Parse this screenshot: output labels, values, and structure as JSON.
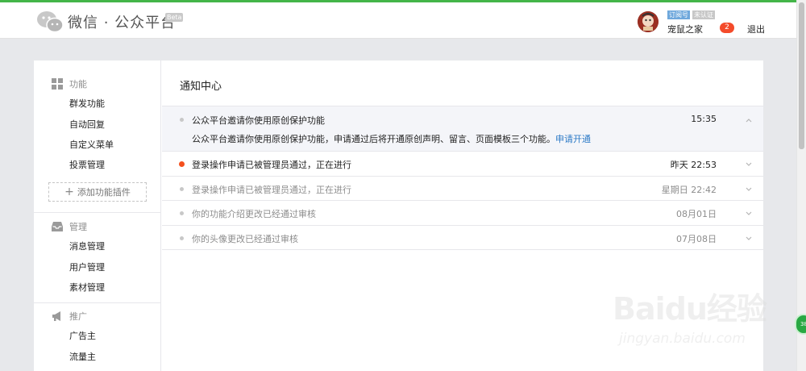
{
  "header": {
    "brand": "微信 · 公众平台",
    "beta": "Beta",
    "account_type_tag": "订阅号",
    "verify_tag": "未认证",
    "account_name": "宠鼠之家",
    "notice_count": "2",
    "logout_label": "退出"
  },
  "sidebar": {
    "groups": [
      {
        "label": "功能",
        "icon": "grid-icon",
        "items": [
          "群发功能",
          "自动回复",
          "自定义菜单",
          "投票管理"
        ]
      },
      {
        "label": "管理",
        "icon": "inbox-icon",
        "items": [
          "消息管理",
          "用户管理",
          "素材管理"
        ]
      },
      {
        "label": "推广",
        "icon": "megaphone-icon",
        "items": [
          "广告主",
          "流量主"
        ]
      }
    ],
    "add_plugin_label": "添加功能插件"
  },
  "main": {
    "title": "通知中心",
    "notifications": [
      {
        "title": "公众平台邀请你使用原创保护功能",
        "time": "15:35",
        "expanded": true,
        "unread": false,
        "detail": "公众平台邀请你使用原创保护功能，申请通过后将开通原创声明、留言、页面模板三个功能。",
        "detail_link": "申请开通"
      },
      {
        "title": "登录操作申请已被管理员通过，正在进行",
        "time": "昨天 22:53",
        "expanded": false,
        "unread": true
      },
      {
        "title": "登录操作申请已被管理员通过，正在进行",
        "time": "星期日 22:42",
        "expanded": false,
        "unread": false
      },
      {
        "title": "你的功能介绍更改已经通过审核",
        "time": "08月01日",
        "expanded": false,
        "unread": false
      },
      {
        "title": "你的头像更改已经通过审核",
        "time": "07月08日",
        "expanded": false,
        "unread": false
      }
    ]
  },
  "watermark": {
    "logo": "Baidu经验",
    "url": "jingyan.baidu.com"
  },
  "float_button": "38",
  "colors": {
    "accent": "#44b549",
    "link": "#2e7bc7",
    "badge": "#f44b2a",
    "unread_dot": "#f4501e"
  }
}
